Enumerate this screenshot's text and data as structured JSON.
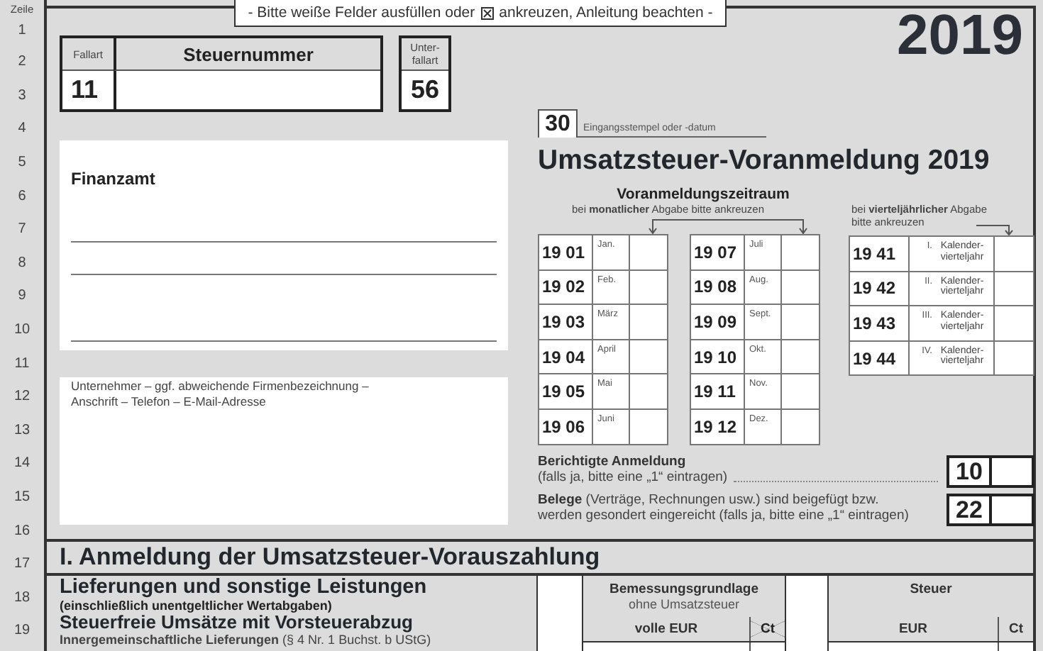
{
  "instructions": {
    "before": "- Bitte weiße Felder ausfüllen oder",
    "after": "ankreuzen, Anleitung beachten -"
  },
  "line_label": "Zeile",
  "line_numbers": [
    "1",
    "2",
    "3",
    "4",
    "5",
    "6",
    "7",
    "8",
    "9",
    "10",
    "11",
    "12",
    "13",
    "14",
    "15",
    "16",
    "17",
    "18",
    "19"
  ],
  "tax_number": {
    "case_type_label": "Fallart",
    "case_type": "11",
    "label": "Steuernummer",
    "subcase_label": "Unter- fallart",
    "subcase": "56"
  },
  "tax_office": {
    "label": "Finanzamt"
  },
  "business": {
    "hint_lines": [
      "Unternehmer – ggf. abweichende Firmenbezeichnung –",
      "Anschrift – Telefon – E-Mail-Adresse"
    ]
  },
  "year": "2019",
  "receipt": {
    "code": "30",
    "label": "Eingangsstempel oder -datum"
  },
  "title": "Umsatzsteuer-Voranmeldung 2019",
  "period": {
    "title": "Voranmeldungszeitraum",
    "monthly_hint": "bei **monatlicher** Abgabe bitte ankreuzen",
    "quarterly_hint": "bei **vierteljährlicher** Abgabe bitte ankreuzen",
    "months": [
      {
        "code": "19 01",
        "label": "Jan.",
        "checked": false
      },
      {
        "code": "19 02",
        "label": "Feb.",
        "checked": false
      },
      {
        "code": "19 03",
        "label": "März",
        "checked": false
      },
      {
        "code": "19 04",
        "label": "April",
        "checked": false
      },
      {
        "code": "19 05",
        "label": "Mai",
        "checked": false
      },
      {
        "code": "19 06",
        "label": "Juni",
        "checked": false
      },
      {
        "code": "19 07",
        "label": "Juli",
        "checked": false
      },
      {
        "code": "19 08",
        "label": "Aug.",
        "checked": false
      },
      {
        "code": "19 09",
        "label": "Sept.",
        "checked": false
      },
      {
        "code": "19 10",
        "label": "Okt.",
        "checked": false
      },
      {
        "code": "19 11",
        "label": "Nov.",
        "checked": false
      },
      {
        "code": "19 12",
        "label": "Dez.",
        "checked": false
      }
    ],
    "quarters": [
      {
        "code": "19 41",
        "numeral": "I.",
        "label": "Kalender- vierteljahr",
        "checked": false
      },
      {
        "code": "19 42",
        "numeral": "II.",
        "label": "Kalender- vierteljahr",
        "checked": false
      },
      {
        "code": "19 43",
        "numeral": "III.",
        "label": "Kalender- vierteljahr",
        "checked": false
      },
      {
        "code": "19 44",
        "numeral": "IV.",
        "label": "Kalender- vierteljahr",
        "checked": false
      }
    ]
  },
  "flags": [
    {
      "kind": "titled",
      "title": "Berichtigte Anmeldung",
      "note": "(falls ja, bitte eine „1“ eintragen)",
      "code": "10"
    },
    {
      "kind": "sentence",
      "text": "**Belege** (Verträge, Rechnungen usw.) sind beigefügt bzw. werden gesondert eingereicht (falls ja, bitte eine „1“ eintragen)",
      "code": "22"
    }
  ],
  "section": {
    "title": "I. Anmeldung der Umsatzsteuer-Vorauszahlung",
    "lines": [
      {
        "kind": "heading",
        "text": "Lieferungen und sonstige Leistungen"
      },
      {
        "kind": "note",
        "text": "(einschließlich unentgeltlicher Wertabgaben)"
      },
      {
        "kind": "subheading",
        "text": "Steuerfreie Umsätze mit Vorsteuerabzug"
      },
      {
        "kind": "item",
        "text": "**Innergemeinschaftliche Lieferungen** (§ 4 Nr. 1 Buchst. b UStG)"
      }
    ],
    "columns": [
      {
        "title": "Bemessungsgrundlage",
        "subtitle": "ohne Umsatzsteuer",
        "units": [
          {
            "label": "volle EUR",
            "crossed_out": false
          },
          {
            "label": "Ct",
            "crossed_out": true
          }
        ]
      },
      {
        "title": "Steuer",
        "units": [
          {
            "label": "EUR",
            "crossed_out": false
          },
          {
            "label": "Ct",
            "crossed_out": false
          }
        ]
      }
    ]
  }
}
